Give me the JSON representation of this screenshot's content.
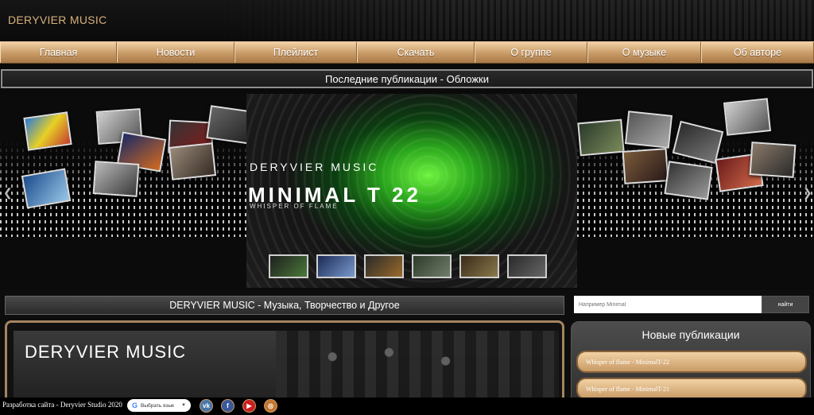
{
  "header": {
    "logo": "DERYVIER MUSIC"
  },
  "nav": {
    "items": [
      {
        "label": "Главная",
        "width": 147
      },
      {
        "label": "Новости",
        "width": 148
      },
      {
        "label": "Плейлист",
        "width": 154
      },
      {
        "label": "Скачать",
        "width": 148
      },
      {
        "label": "О группе",
        "width": 142
      },
      {
        "label": "О музыке",
        "width": 143
      },
      {
        "label": "Об авторе",
        "width": 142
      }
    ]
  },
  "section": {
    "title": "Последние публикации - Обложки"
  },
  "slider": {
    "slide_brand": "DERYVIER MUSIC",
    "slide_title": "MINIMAL T 22",
    "slide_subtitle": "WHISPER OF FLAME",
    "prev_icon": "chevron-left-icon",
    "next_icon": "chevron-right-icon",
    "thumbnail_count": 6
  },
  "main": {
    "site_title": "DERYVIER MUSIC - Музыка, Творчество и Другое",
    "banner_title": "DERYVIER MUSIC"
  },
  "search": {
    "placeholder": "Например Minimal",
    "button": "найти"
  },
  "news": {
    "title": "Новые публикации",
    "items": [
      "Whisper of flame - MinimalT-22",
      "Whisper of flame - MinimalT-21"
    ]
  },
  "footer": {
    "credit": "Разработка сайта - Deryvier Studio 2020",
    "language_button": "Выбрать язык",
    "social": [
      {
        "icon": "vk-icon",
        "glyph": "vk",
        "color": "#4a76a8"
      },
      {
        "icon": "facebook-icon",
        "glyph": "f",
        "color": "#3b5998"
      },
      {
        "icon": "youtube-icon",
        "glyph": "▶",
        "color": "#cc1f1f"
      },
      {
        "icon": "instagram-icon",
        "glyph": "◎",
        "color": "#c2762e"
      }
    ]
  },
  "colors": {
    "accent": "#c89a66",
    "accent_light": "#f1d2a8",
    "background": "#0a0a0a",
    "slide_green": "#29a51c"
  }
}
